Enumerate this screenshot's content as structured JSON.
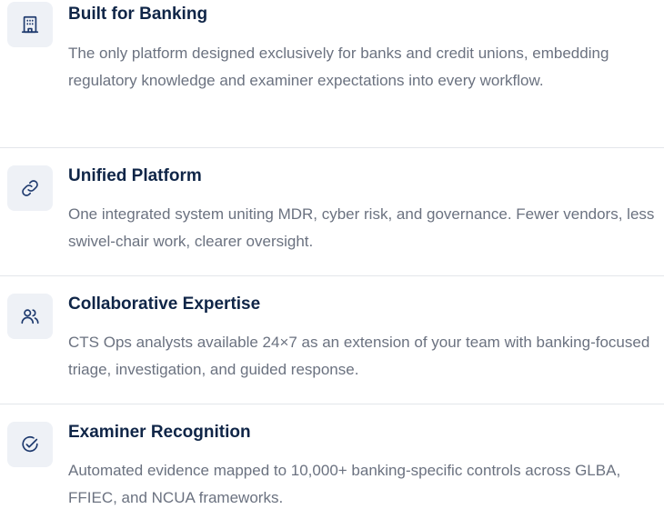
{
  "features": [
    {
      "icon": "bank-building-icon",
      "title": "Built for Banking",
      "description": "The only platform designed exclusively for banks and credit unions, embedding regulatory knowledge and examiner expectations into every workflow."
    },
    {
      "icon": "link-icon",
      "title": "Unified Platform",
      "description": "One integrated system uniting MDR, cyber risk, and governance. Fewer vendors, less swivel-chair work, clearer oversight."
    },
    {
      "icon": "users-icon",
      "title": "Collaborative Expertise",
      "description": "CTS Ops analysts available 24×7 as an extension of your team with banking-focused triage, investigation, and guided response."
    },
    {
      "icon": "check-circle-icon",
      "title": "Examiner Recognition",
      "description": "Automated evidence mapped to 10,000+ banking-specific controls across GLBA, FFIEC, and NCUA frameworks."
    }
  ],
  "colors": {
    "title": "#0f2547",
    "description": "#6b7280",
    "icon_stroke": "#1e3a6e",
    "icon_bg": "#eef1f6",
    "divider": "#e3e6ea"
  }
}
